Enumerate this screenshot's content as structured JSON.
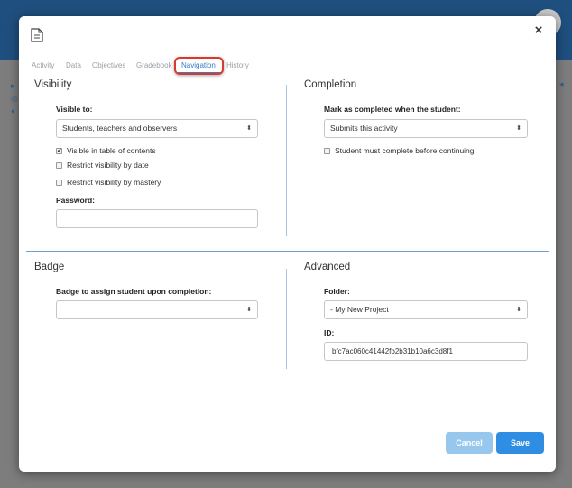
{
  "tabs": [
    {
      "label": "Activity"
    },
    {
      "label": "Data"
    },
    {
      "label": "Objectives"
    },
    {
      "label": "Gradebook"
    },
    {
      "label": "Navigation",
      "active": true
    },
    {
      "label": "History"
    }
  ],
  "close_label": "×",
  "visibility": {
    "title": "Visibility",
    "visible_to_label": "Visible to:",
    "visible_to_value": "Students, teachers and observers",
    "checkboxes": [
      {
        "label": "Visible in table of contents",
        "checked": true
      },
      {
        "label": "Restrict visibility by date",
        "checked": false
      },
      {
        "label": "Restrict visibility by mastery",
        "checked": false
      }
    ],
    "password_label": "Password:",
    "password_value": ""
  },
  "completion": {
    "title": "Completion",
    "mark_label": "Mark as completed when the student:",
    "mark_value": "Submits this activity",
    "must_complete_label": "Student must complete before continuing",
    "must_complete_checked": false
  },
  "badge": {
    "title": "Badge",
    "assign_label": "Badge to assign student upon completion:",
    "assign_value": ""
  },
  "advanced": {
    "title": "Advanced",
    "folder_label": "Folder:",
    "folder_value": "- My New Project",
    "id_label": "ID:",
    "id_value": "bfc7ac060c41442fb2b31b10a6c3d8f1"
  },
  "footer": {
    "cancel_label": "Cancel",
    "save_label": "Save"
  },
  "colors": {
    "accent": "#2f8de4",
    "accent_light": "#98c7ee",
    "highlight": "#d93a2b",
    "header": "#1f4f7e"
  },
  "icons": {
    "document": "document-icon",
    "close": "close-icon",
    "select_arrows": "select-arrows-icon",
    "check": "check-icon"
  }
}
